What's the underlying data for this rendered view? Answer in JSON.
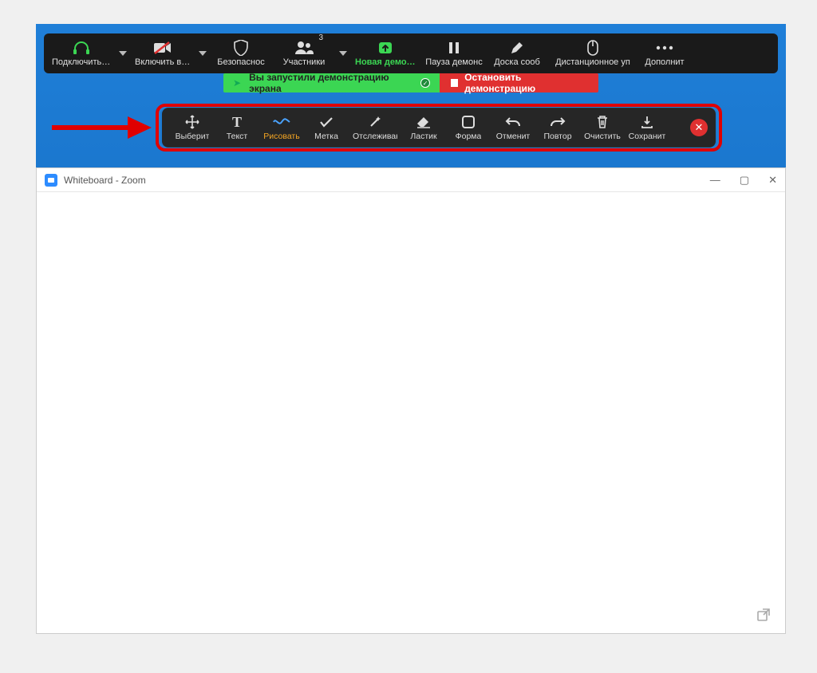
{
  "main_toolbar": {
    "audio": "Подключить зв",
    "video": "Включить вид",
    "security": "Безопаснос",
    "participants": "Участники",
    "participants_count": "3",
    "new_share": "Новая демонс",
    "pause_share": "Пауза демонс",
    "whiteboard": "Доска сооб",
    "remote": "Дистанционное уп",
    "more": "Дополнит"
  },
  "notice": {
    "started": "Вы запустили демонстрацию экрана",
    "stop": "Остановить демонстрацию"
  },
  "annotation": {
    "select": "Выберит",
    "text": "Текст",
    "draw": "Рисовать",
    "stamp": "Метка",
    "spotlight": "Отслеживан",
    "eraser": "Ластик",
    "format": "Форма",
    "undo": "Отменит",
    "redo": "Повтор",
    "clear": "Очистить",
    "save": "Сохранит"
  },
  "whiteboard": {
    "title": "Whiteboard - Zoom"
  }
}
